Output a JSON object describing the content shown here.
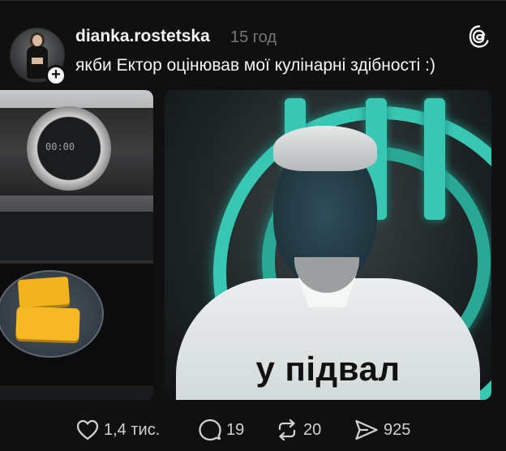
{
  "post": {
    "username": "dianka.rostetska",
    "time": "15 год",
    "caption": "якби Ектор оцінював мої кулінарні здібності :)",
    "follow_plus": "+"
  },
  "media": {
    "oven_display": "00:00",
    "meme_text": "у підвал"
  },
  "actions": {
    "likes": "1,4 тис.",
    "comments": "19",
    "reposts": "20",
    "shares": "925"
  },
  "icons": {
    "brand": "threads-icon",
    "like": "heart-icon",
    "comment": "comment-bubble-icon",
    "repost": "repost-icon",
    "share": "send-icon"
  },
  "colors": {
    "background": "#101010",
    "text": "#f3f5f7",
    "muted": "#777777",
    "teal_ring": "#38c7b2",
    "cheese": "#f6b925"
  }
}
